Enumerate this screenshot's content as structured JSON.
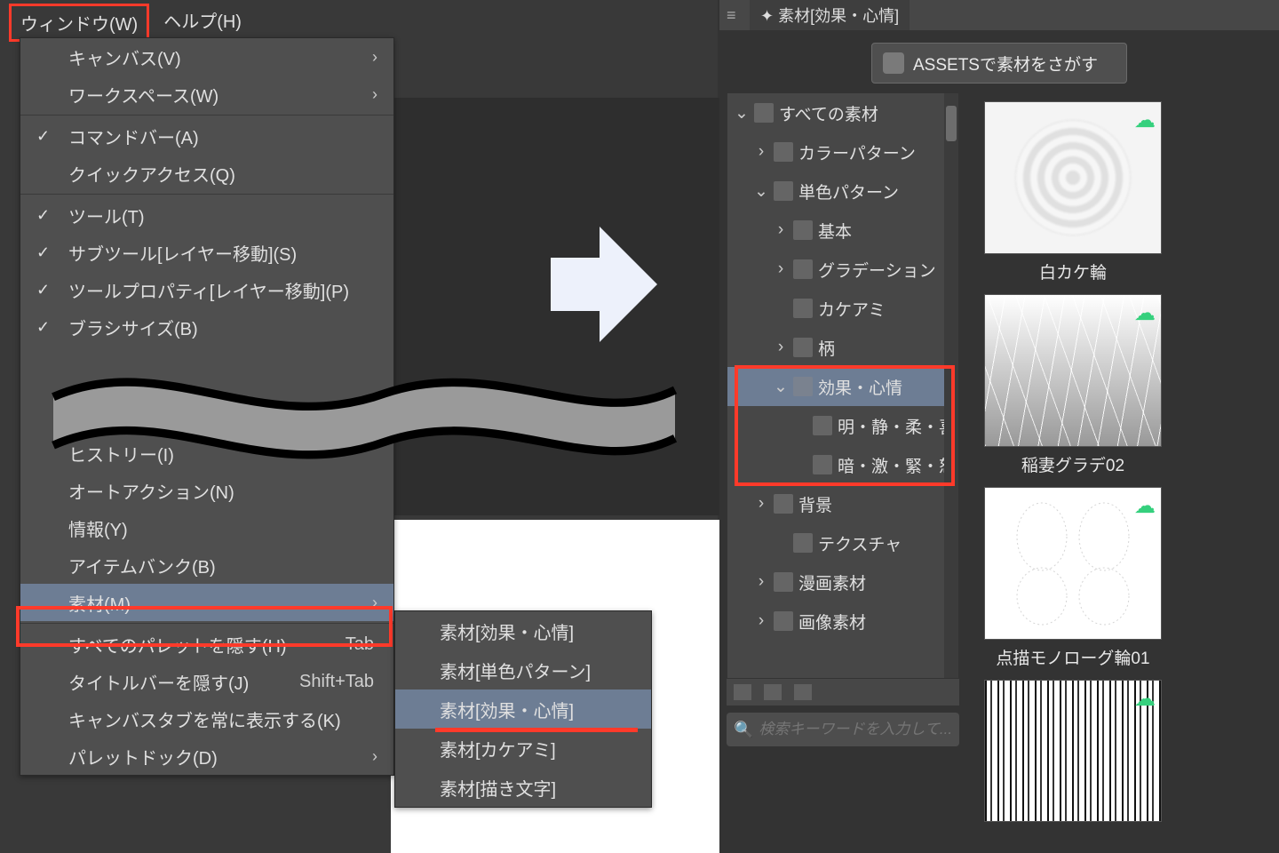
{
  "menubar": {
    "window": "ウィンドウ(W)",
    "help": "ヘルプ(H)"
  },
  "menu": {
    "canvas": "キャンバス(V)",
    "workspace": "ワークスペース(W)",
    "commandbar": "コマンドバー(A)",
    "quickaccess": "クイックアクセス(Q)",
    "tool": "ツール(T)",
    "subtool": "サブツール[レイヤー移動](S)",
    "toolprop": "ツールプロパティ[レイヤー移動](P)",
    "brushsize": "ブラシサイズ(B)",
    "history": "ヒストリー(I)",
    "autoaction": "オートアクション(N)",
    "info": "情報(Y)",
    "itembank": "アイテムバンク(B)",
    "material": "素材(M)",
    "hideall": "すべてのパレットを隠す(H)",
    "hideall_accel": "Tab",
    "hidetitle": "タイトルバーを隠す(J)",
    "hidetitle_accel": "Shift+Tab",
    "canvastab": "キャンバスタブを常に表示する(K)",
    "palettedock": "パレットドック(D)"
  },
  "submenu": {
    "a": "素材[効果・心情]",
    "b": "素材[単色パターン]",
    "c": "素材[効果・心情]",
    "d": "素材[カケアミ]",
    "e": "素材[描き文字]"
  },
  "panel": {
    "title": "素材[効果・心情]",
    "assets_btn": "ASSETSで素材をさがす",
    "search_placeholder": "検索キーワードを入力して..."
  },
  "tree": {
    "all": "すべての素材",
    "colorpattern": "カラーパターン",
    "monopattern": "単色パターン",
    "basic": "基本",
    "gradation": "グラデーション",
    "kakeami": "カケアミ",
    "gara": "柄",
    "koukashinjou": "効果・心情",
    "meiseijuu": "明・静・柔・喜",
    "angekikin": "暗・激・緊・怒",
    "haikei": "背景",
    "texture": "テクスチャ",
    "manga": "漫画素材",
    "gazou": "画像素材"
  },
  "thumbs": {
    "t1": "白カケ輪",
    "t2": "稲妻グラデ02",
    "t3": "点描モノローグ輪01"
  }
}
